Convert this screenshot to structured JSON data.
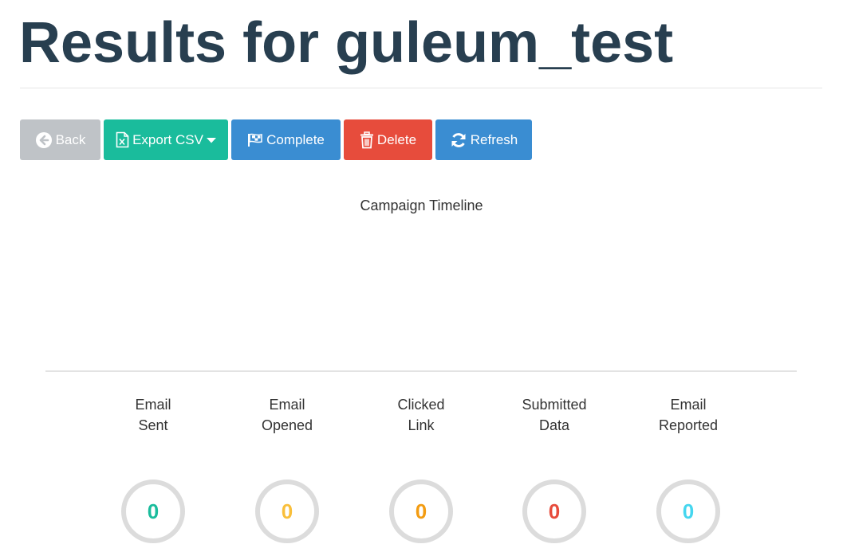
{
  "page": {
    "title": "Results for guleum_test"
  },
  "toolbar": {
    "back_label": "Back",
    "export_label": "Export CSV",
    "complete_label": "Complete",
    "delete_label": "Delete",
    "refresh_label": "Refresh",
    "icons": [
      "arrow-circle-left-icon",
      "file-excel-icon",
      "caret-down-icon",
      "checkered-flag-icon",
      "trash-icon",
      "refresh-icon"
    ]
  },
  "timeline": {
    "title": "Campaign Timeline"
  },
  "stats": [
    {
      "label_line1": "Email",
      "label_line2": "Sent",
      "value": "0",
      "color": "#1abc9c"
    },
    {
      "label_line1": "Email",
      "label_line2": "Opened",
      "value": "0",
      "color": "#f9bf3b"
    },
    {
      "label_line1": "Clicked",
      "label_line2": "Link",
      "value": "0",
      "color": "#f39c12"
    },
    {
      "label_line1": "Submitted",
      "label_line2": "Data",
      "value": "0",
      "color": "#e74c3c"
    },
    {
      "label_line1": "Email",
      "label_line2": "Reported",
      "value": "0",
      "color": "#45d6ef"
    }
  ],
  "colors": {
    "title": "#283f50",
    "back": "#bfc3c7",
    "export": "#1abc9c",
    "complete": "#3a8dd2",
    "delete": "#e74c3c",
    "refresh": "#3a8dd2"
  }
}
